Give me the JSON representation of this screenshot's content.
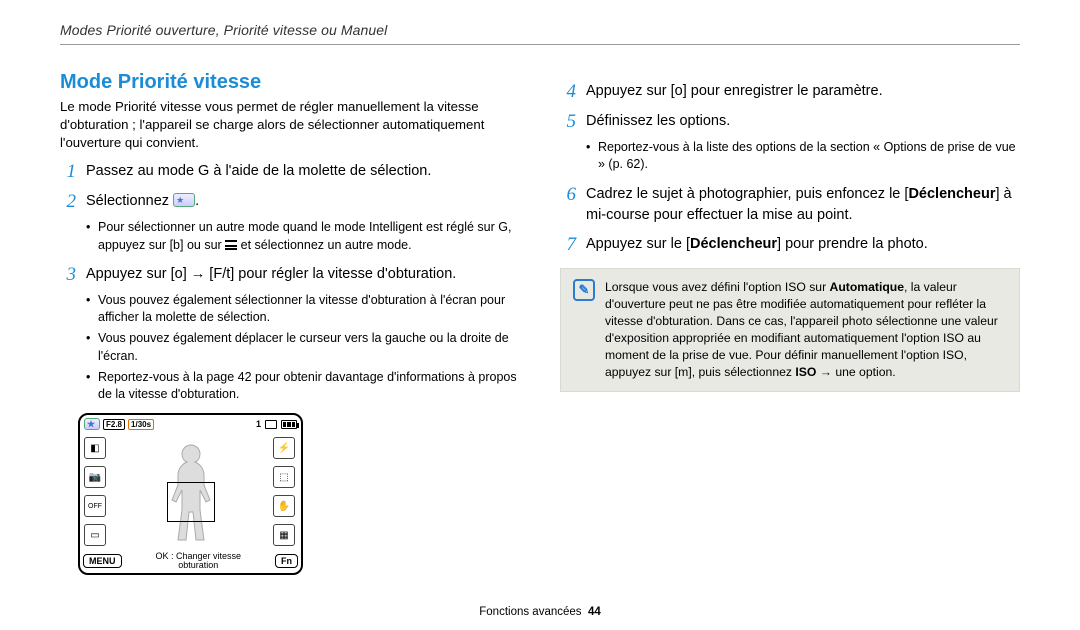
{
  "header": {
    "breadcrumb": "Modes Priorité ouverture, Priorité vitesse ou Manuel"
  },
  "left": {
    "title": "Mode Priorité vitesse",
    "intro": "Le mode Priorité vitesse vous permet de régler manuellement la vitesse d'obturation ; l'appareil se charge alors de sélectionner automatiquement l'ouverture qui convient.",
    "step1": {
      "num": "1",
      "text_a": "Passez au mode ",
      "token": "G",
      "text_b": " à l'aide de la molette de sélection."
    },
    "step2": {
      "num": "2",
      "text_a": "Sélectionnez ",
      "text_b": "."
    },
    "step2_sub1_a": "Pour sélectionner un autre mode quand le mode Intelligent est réglé sur ",
    "step2_sub1_token": "G",
    "step2_sub1_b": ", appuyez sur [b] ou sur ",
    "step2_sub1_c": " et sélectionnez un autre mode.",
    "step3": {
      "num": "3",
      "text": "Appuyez sur [o] → [F/t] pour régler la vitesse d'obturation."
    },
    "step3_sub1": "Vous pouvez également sélectionner la vitesse d'obturation à l'écran pour afficher la molette de sélection.",
    "step3_sub2": "Vous pouvez également déplacer le curseur vers la gauche ou la droite de l'écran.",
    "step3_sub3": "Reportez-vous à la page 42 pour obtenir davantage d'informations à propos de la vitesse d'obturation.",
    "screenshot": {
      "f_value": "F2.8",
      "shutter": "1/30s",
      "count": "1",
      "menu_label": "MENU",
      "fn_label": "Fn",
      "center_a": "OK : Changer vitesse",
      "center_b": "obturation",
      "side_off": "OFF"
    }
  },
  "right": {
    "step4": {
      "num": "4",
      "text": "Appuyez sur [o] pour enregistrer le paramètre."
    },
    "step5": {
      "num": "5",
      "text": "Définissez les options."
    },
    "step5_sub1": "Reportez-vous à la liste des options de la section « Options de prise de vue » (p. 62).",
    "step6": {
      "num": "6",
      "text_a": "Cadrez le sujet à photographier, puis enfoncez le [",
      "bold": "Déclencheur",
      "text_b": "] à mi-course pour effectuer la mise au point."
    },
    "step7": {
      "num": "7",
      "text_a": "Appuyez sur le [",
      "bold": "Déclencheur",
      "text_b": "] pour prendre la photo."
    },
    "note_a": "Lorsque vous avez défini l'option ISO sur ",
    "note_bold1": "Automatique",
    "note_b": ", la valeur d'ouverture peut ne pas être modifiée automatiquement pour refléter la vitesse d'obturation. Dans ce cas, l'appareil photo sélectionne une valeur d'exposition appropriée en modifiant automatiquement l'option ISO au moment de la prise de vue. Pour définir manuellement l'option ISO, appuyez sur [m], puis sélectionnez ",
    "note_bold2": "ISO",
    "note_c": " → une option."
  },
  "footer": {
    "section": "Fonctions avancées",
    "page": "44"
  }
}
